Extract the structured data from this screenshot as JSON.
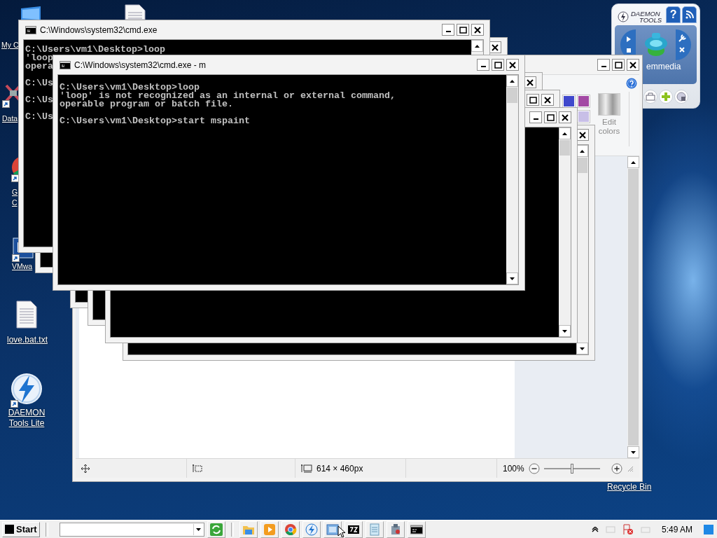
{
  "desktop_icons": [
    {
      "kind": "computer",
      "label": "My C"
    },
    {
      "kind": "network",
      "label": "Data"
    },
    {
      "kind": "chrome",
      "label": "G C"
    },
    {
      "kind": "vmware",
      "label": "VMwa"
    },
    {
      "kind": "text_file",
      "label": "love.bat.txt"
    },
    {
      "kind": "daemon",
      "label": "DAEMON Tools Lite"
    }
  ],
  "recycle_bin": {
    "label": "Recycle Bin"
  },
  "daemon_gadget": {
    "logo": [
      "DAEMON",
      "TOOLS"
    ],
    "help_tab": "?",
    "drive_label": "emmedia"
  },
  "paint_window": {
    "palette": [
      {
        "color": "#3f48cc"
      },
      {
        "color": "#a349a4"
      },
      {
        "color": "#c8bfe7"
      }
    ],
    "edit_colors": "Edit colors",
    "status_bar": {
      "image_size": "614 × 460px",
      "zoom": "100%"
    },
    "zoom_slider": {
      "level": 0.5
    }
  },
  "console_windows": [
    {
      "title": "C:\\Windows\\system32\\cmd.exe",
      "blocks": [
        [
          "C:\\Users\\vm1\\Desktop>loop",
          "'loop",
          "opera"
        ],
        [
          "C:\\Us"
        ],
        [
          "C:\\Us"
        ],
        [
          "C:\\Us"
        ]
      ]
    },
    {
      "title": "C:\\Windows\\system32\\cmd.exe - m",
      "blocks": [
        [
          "C:\\Users\\vm1\\Desktop>loop",
          "'loop' is not recognized as an internal or external command,",
          "operable program or batch file."
        ],
        [
          "C:\\Users\\vm1\\Desktop>start mspaint"
        ]
      ]
    }
  ],
  "taskbar": {
    "start": "Start",
    "clock": "5:49 AM"
  }
}
